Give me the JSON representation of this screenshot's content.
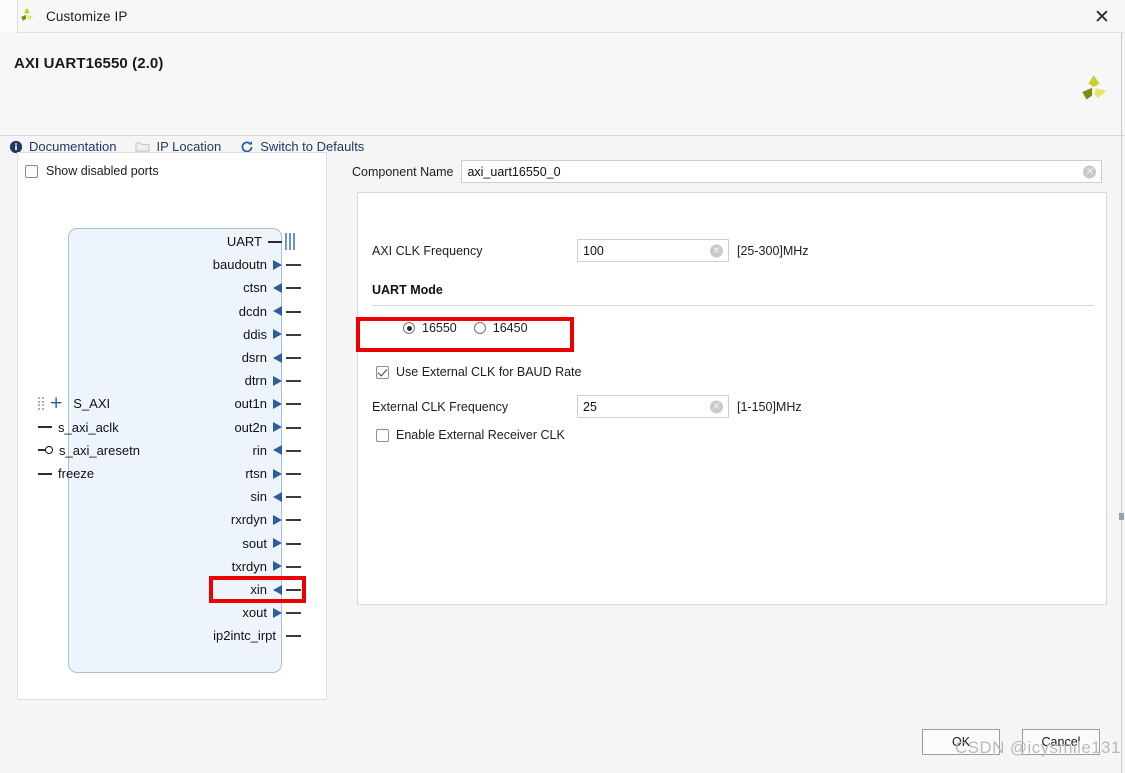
{
  "window": {
    "title": "Customize IP",
    "app_icon": "xilinx-logo-icon",
    "close_label": "✕"
  },
  "header": {
    "ip_title": "AXI UART16550 (2.0)",
    "logo": "xilinx-logo-icon",
    "toolbar": [
      {
        "label": "Documentation",
        "icon": "info-icon"
      },
      {
        "label": "IP Location",
        "icon": "folder-icon"
      },
      {
        "label": "Switch to Defaults",
        "icon": "refresh-icon"
      }
    ]
  },
  "ports_panel": {
    "show_disabled_ports": {
      "label": "Show disabled ports",
      "checked": false
    },
    "block": {
      "right_ports": [
        {
          "name": "UART",
          "kind": "bus"
        },
        {
          "name": "baudoutn",
          "kind": "out"
        },
        {
          "name": "ctsn",
          "kind": "in"
        },
        {
          "name": "dcdn",
          "kind": "in"
        },
        {
          "name": "ddis",
          "kind": "out"
        },
        {
          "name": "dsrn",
          "kind": "in"
        },
        {
          "name": "dtrn",
          "kind": "out"
        },
        {
          "name": "out1n",
          "kind": "out"
        },
        {
          "name": "out2n",
          "kind": "out"
        },
        {
          "name": "rin",
          "kind": "in"
        },
        {
          "name": "rtsn",
          "kind": "out"
        },
        {
          "name": "sin",
          "kind": "in"
        },
        {
          "name": "rxrdyn",
          "kind": "out"
        },
        {
          "name": "sout",
          "kind": "out"
        },
        {
          "name": "txrdyn",
          "kind": "out"
        },
        {
          "name": "xin",
          "kind": "in",
          "highlighted": true
        },
        {
          "name": "xout",
          "kind": "out"
        },
        {
          "name": "ip2intc_irpt",
          "kind": "plain"
        }
      ],
      "left_ports": [
        {
          "name": "S_AXI",
          "kind": "bus-group"
        },
        {
          "name": "s_axi_aclk",
          "kind": "clk"
        },
        {
          "name": "s_axi_aresetn",
          "kind": "rst-low"
        },
        {
          "name": "freeze",
          "kind": "clk"
        }
      ]
    }
  },
  "config": {
    "component_name": {
      "label": "Component Name",
      "value": "axi_uart16550_0"
    },
    "axi_clk_frequency": {
      "label": "AXI CLK Frequency",
      "value": "100",
      "unit": "[25-300]MHz"
    },
    "uart_mode": {
      "title": "UART Mode",
      "options": [
        {
          "label": "16550",
          "selected": true
        },
        {
          "label": "16450",
          "selected": false
        }
      ]
    },
    "use_external_clk": {
      "label": "Use External CLK for BAUD Rate",
      "checked": true,
      "highlighted": true
    },
    "external_clk_frequency": {
      "label": "External CLK Frequency",
      "value": "25",
      "unit": "[1-150]MHz"
    },
    "enable_external_receiver_clk": {
      "label": "Enable External Receiver CLK",
      "checked": false
    }
  },
  "footer": {
    "ok_label": "OK",
    "cancel_label": "Cancel"
  },
  "watermark": "CSDN @icysmile131",
  "colors": {
    "accent_red": "#ee0000",
    "link_blue": "#1f3864",
    "block_fill": "#eef4fb",
    "block_border": "#a9bfda",
    "arrow_blue": "#2e5d9f"
  }
}
